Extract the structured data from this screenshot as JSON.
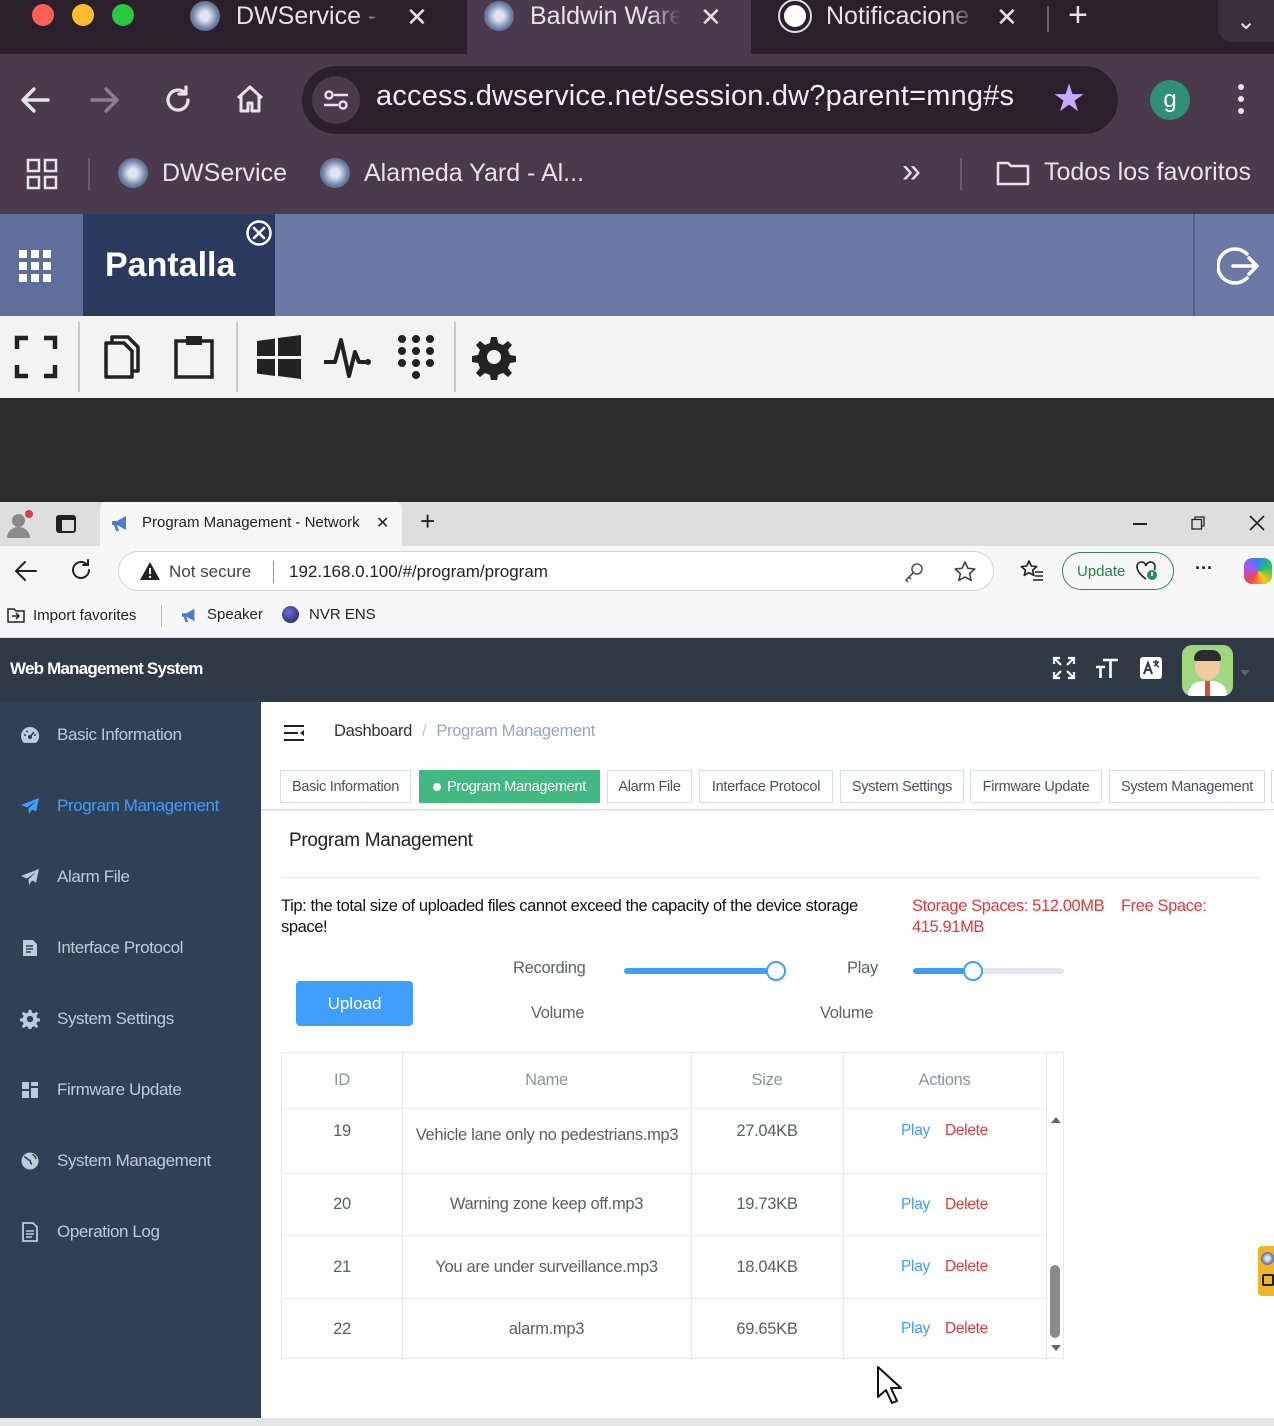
{
  "mac_browser": {
    "tabs": [
      {
        "title": "DWService - ",
        "close": "✕"
      },
      {
        "title": "Baldwin Ware",
        "close": "✕"
      },
      {
        "title": "Notificacione",
        "close": "✕"
      }
    ],
    "new_tab": "+",
    "url": "access.dwservice.net/session.dw?parent=mng#s",
    "profile_initial": "g",
    "bookmarks": [
      "DWService",
      "Alameda Yard - Al..."
    ],
    "bookmarks_overflow": "»",
    "all_bookmarks": "Todos los favoritos"
  },
  "dwservice": {
    "tab_label": "Pantalla"
  },
  "edge": {
    "tab_title": "Program Management - Network",
    "tab_close": "✕",
    "new_tab": "+",
    "security": "Not secure",
    "url": "192.168.0.100/#/program/program",
    "update_label": "Update",
    "more": "···",
    "favorites": [
      "Import favorites",
      "Speaker",
      "NVR ENS"
    ]
  },
  "app": {
    "title": "Web Management System",
    "sidebar": [
      {
        "label": "Basic Information",
        "icon": "dashboard-icon"
      },
      {
        "label": "Program Management",
        "icon": "send-icon",
        "active": true
      },
      {
        "label": "Alarm File",
        "icon": "send-icon"
      },
      {
        "label": "Interface Protocol",
        "icon": "document-icon"
      },
      {
        "label": "System Settings",
        "icon": "gear-icon"
      },
      {
        "label": "Firmware Update",
        "icon": "grid-icon"
      },
      {
        "label": "System Management",
        "icon": "globe-icon"
      },
      {
        "label": "Operation Log",
        "icon": "log-icon"
      }
    ],
    "breadcrumb": [
      "Dashboard",
      "/",
      "Program Management"
    ],
    "tags": [
      "Basic Information",
      "Program Management",
      "Alarm File",
      "Interface Protocol",
      "System Settings",
      "Firmware Update",
      "System Management"
    ],
    "page_title": "Program Management",
    "tip": "Tip: the total size of uploaded files cannot exceed the capacity of the device storage space!",
    "storage": "Storage Spaces: 512.00MB",
    "free_label": "Free Space:",
    "free_value": "415.91MB",
    "upload_label": "Upload",
    "recording_label": "Recording",
    "recording_volume_label": "Volume",
    "play_label": "Play",
    "play_volume_label": "Volume",
    "recording_volume": 1.0,
    "play_volume": 0.4,
    "table": {
      "headers": [
        "ID",
        "Name",
        "Size",
        "Actions"
      ],
      "rows": [
        {
          "id": "19",
          "name": "Vehicle lane only no pedestrians.mp3",
          "size": "27.04KB",
          "play": "Play",
          "delete": "Delete"
        },
        {
          "id": "20",
          "name": "Warning zone keep off.mp3",
          "size": "19.73KB",
          "play": "Play",
          "delete": "Delete"
        },
        {
          "id": "21",
          "name": "You are under surveillance.mp3",
          "size": "18.04KB",
          "play": "Play",
          "delete": "Delete"
        },
        {
          "id": "22",
          "name": "alarm.mp3",
          "size": "69.65KB",
          "play": "Play",
          "delete": "Delete"
        }
      ]
    },
    "colors": {
      "accent": "#409eff",
      "active_tag": "#42b983",
      "danger": "#e4393c",
      "sidebar": "#304156"
    }
  }
}
